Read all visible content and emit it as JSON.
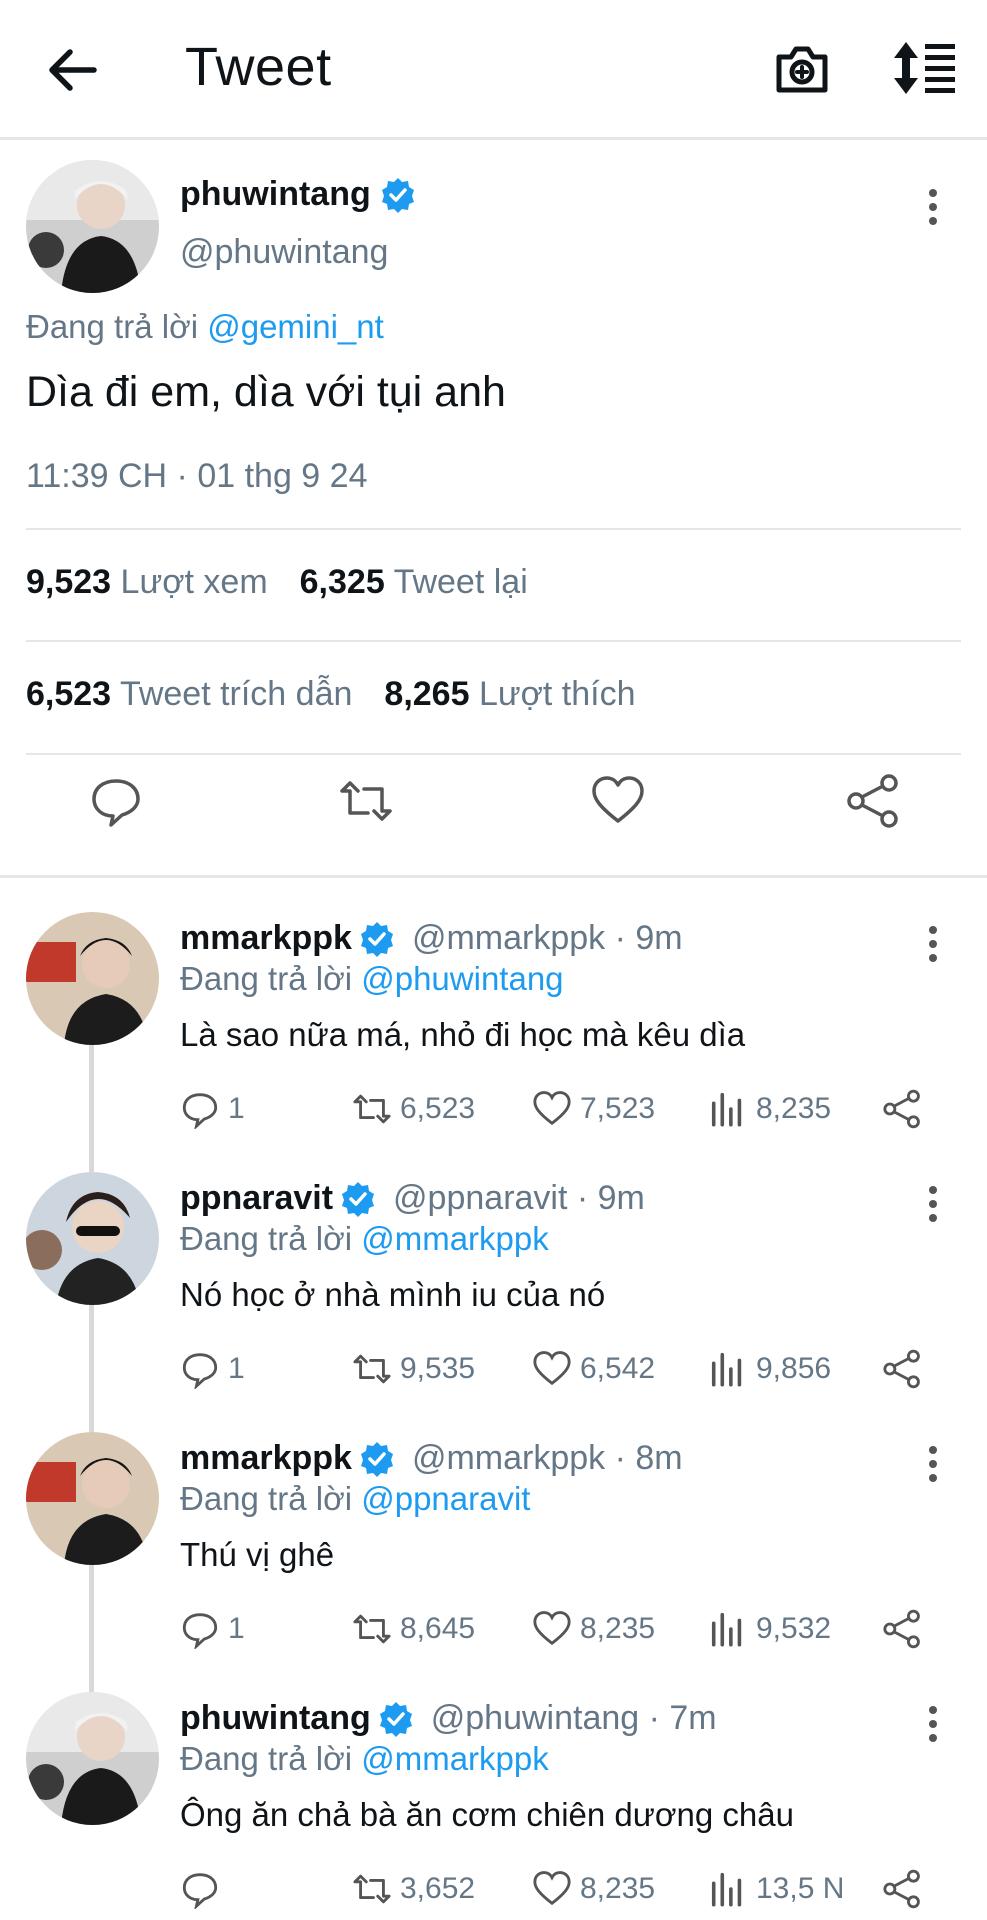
{
  "header": {
    "title": "Tweet",
    "icons": [
      "back-arrow-icon",
      "camera-plus-icon",
      "sort-icon"
    ]
  },
  "main_tweet": {
    "name": "phuwintang",
    "handle": "@phuwintang",
    "reply_prefix": "Đang trả lời",
    "reply_to": "@gemini_nt",
    "text": "Dìa đi em, dìa với tụi anh",
    "timestamp": "11:39 CH · 01 thg 9 24",
    "views_count": "9,523",
    "views_label": "Lượt xem",
    "retweets_count": "6,325",
    "retweets_label": "Tweet lại",
    "quotes_count": "6,523",
    "quotes_label": "Tweet trích dẫn",
    "likes_count": "8,265",
    "likes_label": "Lượt thích"
  },
  "replies": [
    {
      "name": "mmarkppk",
      "handle": "@mmarkppk · 9m",
      "reply_prefix": "Đang trả lời",
      "reply_to": "@phuwintang",
      "text": "Là sao nữa má, nhỏ đi học mà kêu dìa",
      "comments": "1",
      "retweets": "6,523",
      "likes": "7,523",
      "views": "8,235"
    },
    {
      "name": "ppnaravit",
      "handle": "@ppnaravit · 9m",
      "reply_prefix": "Đang trả lời",
      "reply_to": "@mmarkppk",
      "text": "Nó học ở nhà mình iu của nó",
      "comments": "1",
      "retweets": "9,535",
      "likes": "6,542",
      "views": "9,856"
    },
    {
      "name": "mmarkppk",
      "handle": "@mmarkppk · 8m",
      "reply_prefix": "Đang trả lời",
      "reply_to": "@ppnaravit",
      "text": "Thú vị ghê",
      "comments": "1",
      "retweets": "8,645",
      "likes": "8,235",
      "views": "9,532"
    },
    {
      "name": "phuwintang",
      "handle": "@phuwintang · 7m",
      "reply_prefix": "Đang trả lời",
      "reply_to": "@mmarkppk",
      "text": "Ông ăn chả bà ăn cơm chiên dương châu",
      "comments": "",
      "retweets": "3,652",
      "likes": "8,235",
      "views": "13,5 N"
    }
  ],
  "colors": {
    "accent": "#1d9bf0",
    "muted": "#657786",
    "text": "#0f1419",
    "divider": "#e6e6e6"
  }
}
